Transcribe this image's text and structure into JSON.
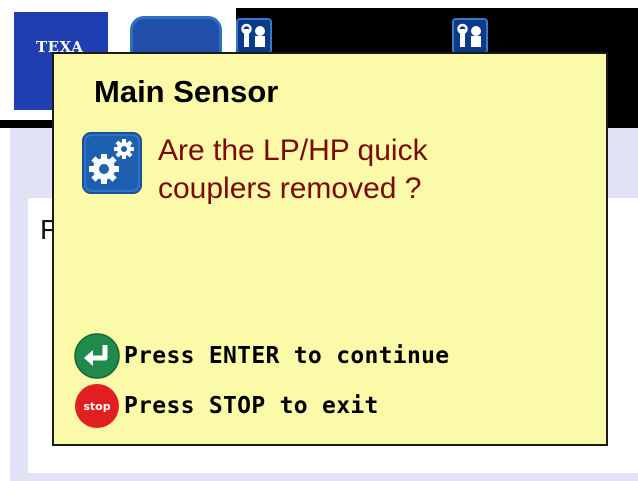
{
  "background_app": {
    "logo_text": "TEXA",
    "partial_label": "F",
    "tool_icon_name": "technician-tools-icon",
    "colors": {
      "logo_blue": "#1f3fb0",
      "app_background": "#e2e2f6",
      "top_bar": "#000000"
    }
  },
  "dialog": {
    "title": "Main Sensor",
    "question": "Are the LP/HP quick couplers removed ?",
    "icon": "gears-icon",
    "actions": {
      "enter": {
        "icon": "enter-key-icon",
        "label": "Press ENTER to continue"
      },
      "stop": {
        "icon": "stop-sign-icon",
        "icon_text": "stop",
        "label": "Press STOP to exit"
      }
    },
    "colors": {
      "background": "#fafaa8",
      "question_text": "#7a0a0a",
      "enter_green": "#1f8a4c",
      "stop_red": "#e02020"
    }
  }
}
